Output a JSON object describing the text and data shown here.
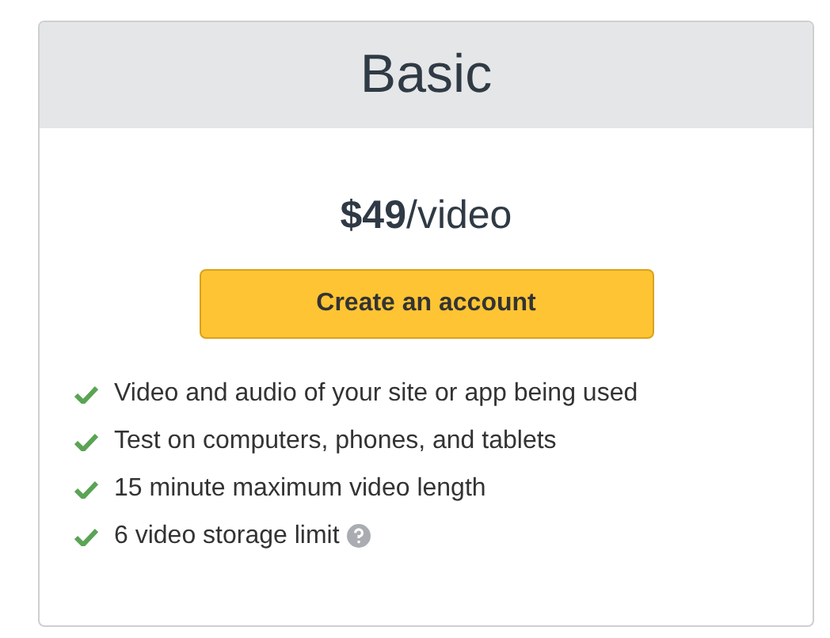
{
  "plan": {
    "title": "Basic",
    "price": "**$49**/video",
    "button": "Create an account",
    "features": [
      {
        "text": "Video and audio of your site or app being used",
        "help": false
      },
      {
        "text": "Test on computers, phones, and tablets",
        "help": false
      },
      {
        "text": "15 minute maximum video length",
        "help": false
      },
      {
        "text": "6 video storage limit",
        "help": true
      }
    ]
  }
}
